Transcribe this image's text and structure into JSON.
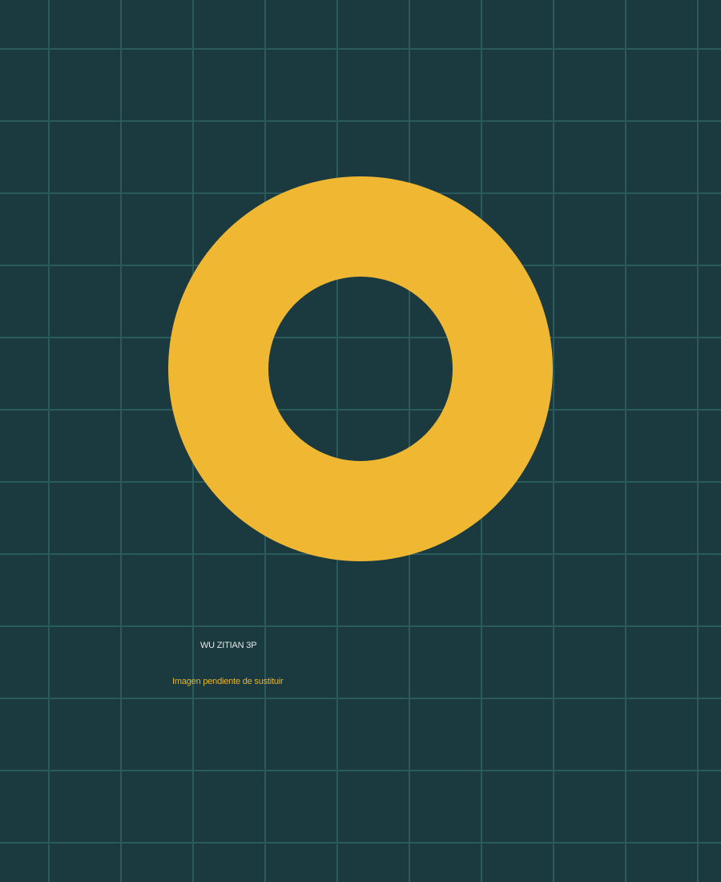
{
  "colors": {
    "background": "#1a3a40",
    "grid_line": "#2a5a5c",
    "ring": "#f0b732",
    "name_text": "#e6e6e6",
    "note_text": "#e8b42c"
  },
  "graphic": {
    "icon": "ring-icon"
  },
  "caption": {
    "name": "WU ZITIAN 3P",
    "note": "Imagen pendiente de sustituir"
  }
}
